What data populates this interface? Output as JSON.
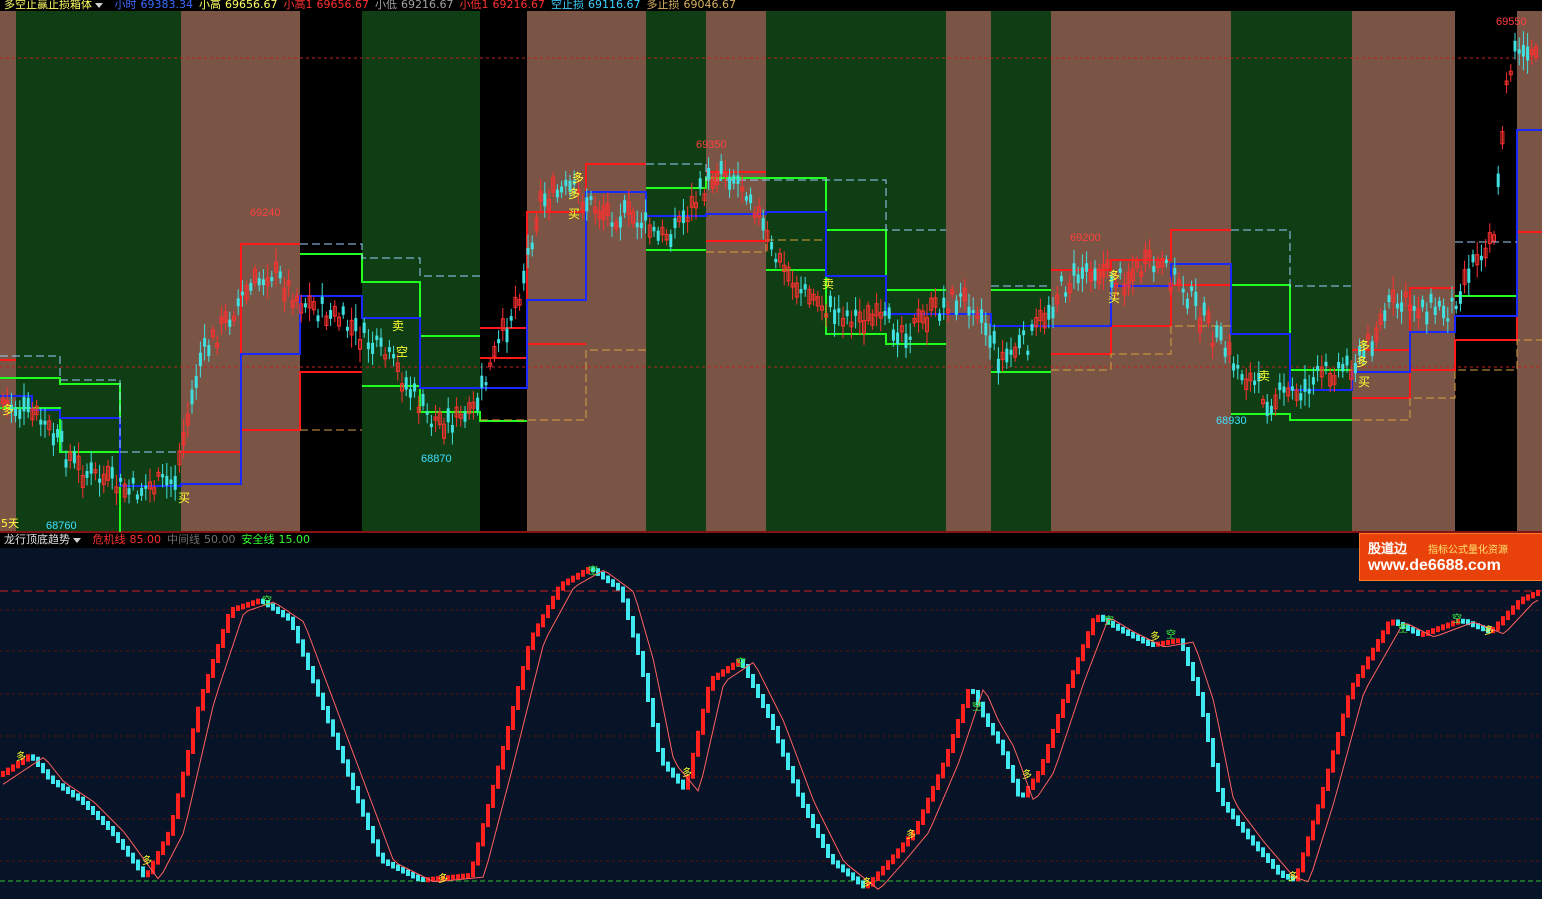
{
  "top_panel": {
    "indicator_name": "多空止赢止损箱体",
    "legend_items": [
      {
        "label": "小时",
        "value": "69383.34",
        "color": "#3a6bff"
      },
      {
        "label": "小高",
        "value": "69656.67",
        "color": "#ffff66"
      },
      {
        "label": "小高1",
        "value": "69656.67",
        "color": "#ff3030"
      },
      {
        "label": "小低",
        "value": "69216.67",
        "color": "#a0a0a0"
      },
      {
        "label": "小低1",
        "value": "69216.67",
        "color": "#ff3030"
      },
      {
        "label": "空止损",
        "value": "69116.67",
        "color": "#40d0ff"
      },
      {
        "label": "多止损",
        "value": "69046.67",
        "color": "#d8b060"
      }
    ],
    "price_labels": [
      {
        "text": "69550",
        "color": "#ff4040"
      },
      {
        "text": "69350",
        "color": "#ff4040"
      },
      {
        "text": "69240",
        "color": "#ff4040"
      },
      {
        "text": "69200",
        "color": "#ff4040"
      },
      {
        "text": "68870",
        "color": "#40e0ff"
      },
      {
        "text": "68930",
        "color": "#40e0ff"
      },
      {
        "text": "68760",
        "color": "#40e0ff"
      }
    ],
    "period_label": "5天",
    "signal_buy": "买",
    "signal_sell": "卖",
    "signal_long": "多",
    "signal_short": "空"
  },
  "bottom_panel": {
    "indicator_name": "龙行顶底趋势",
    "legend_items": [
      {
        "label": "危机线",
        "value": "85.00",
        "color": "#ff3030"
      },
      {
        "label": "中间线",
        "value": "50.00",
        "color": "#707070"
      },
      {
        "label": "安全线",
        "value": "15.00",
        "color": "#30ff30"
      }
    ],
    "signal_long": "多",
    "signal_short": "空"
  },
  "watermark": {
    "brand": "股道边",
    "subtitle": "指标公式量化资源",
    "url": "www.de6688.com"
  },
  "colors": {
    "green_box": "#0f3d14",
    "brown_box": "#7a5545",
    "up_candle": "#ff3030",
    "down_candle": "#40e0e0",
    "box_red": "#ff1a1a",
    "box_green": "#20ff20",
    "box_blue": "#1a2aff",
    "bottom_bg": "#071326"
  }
}
